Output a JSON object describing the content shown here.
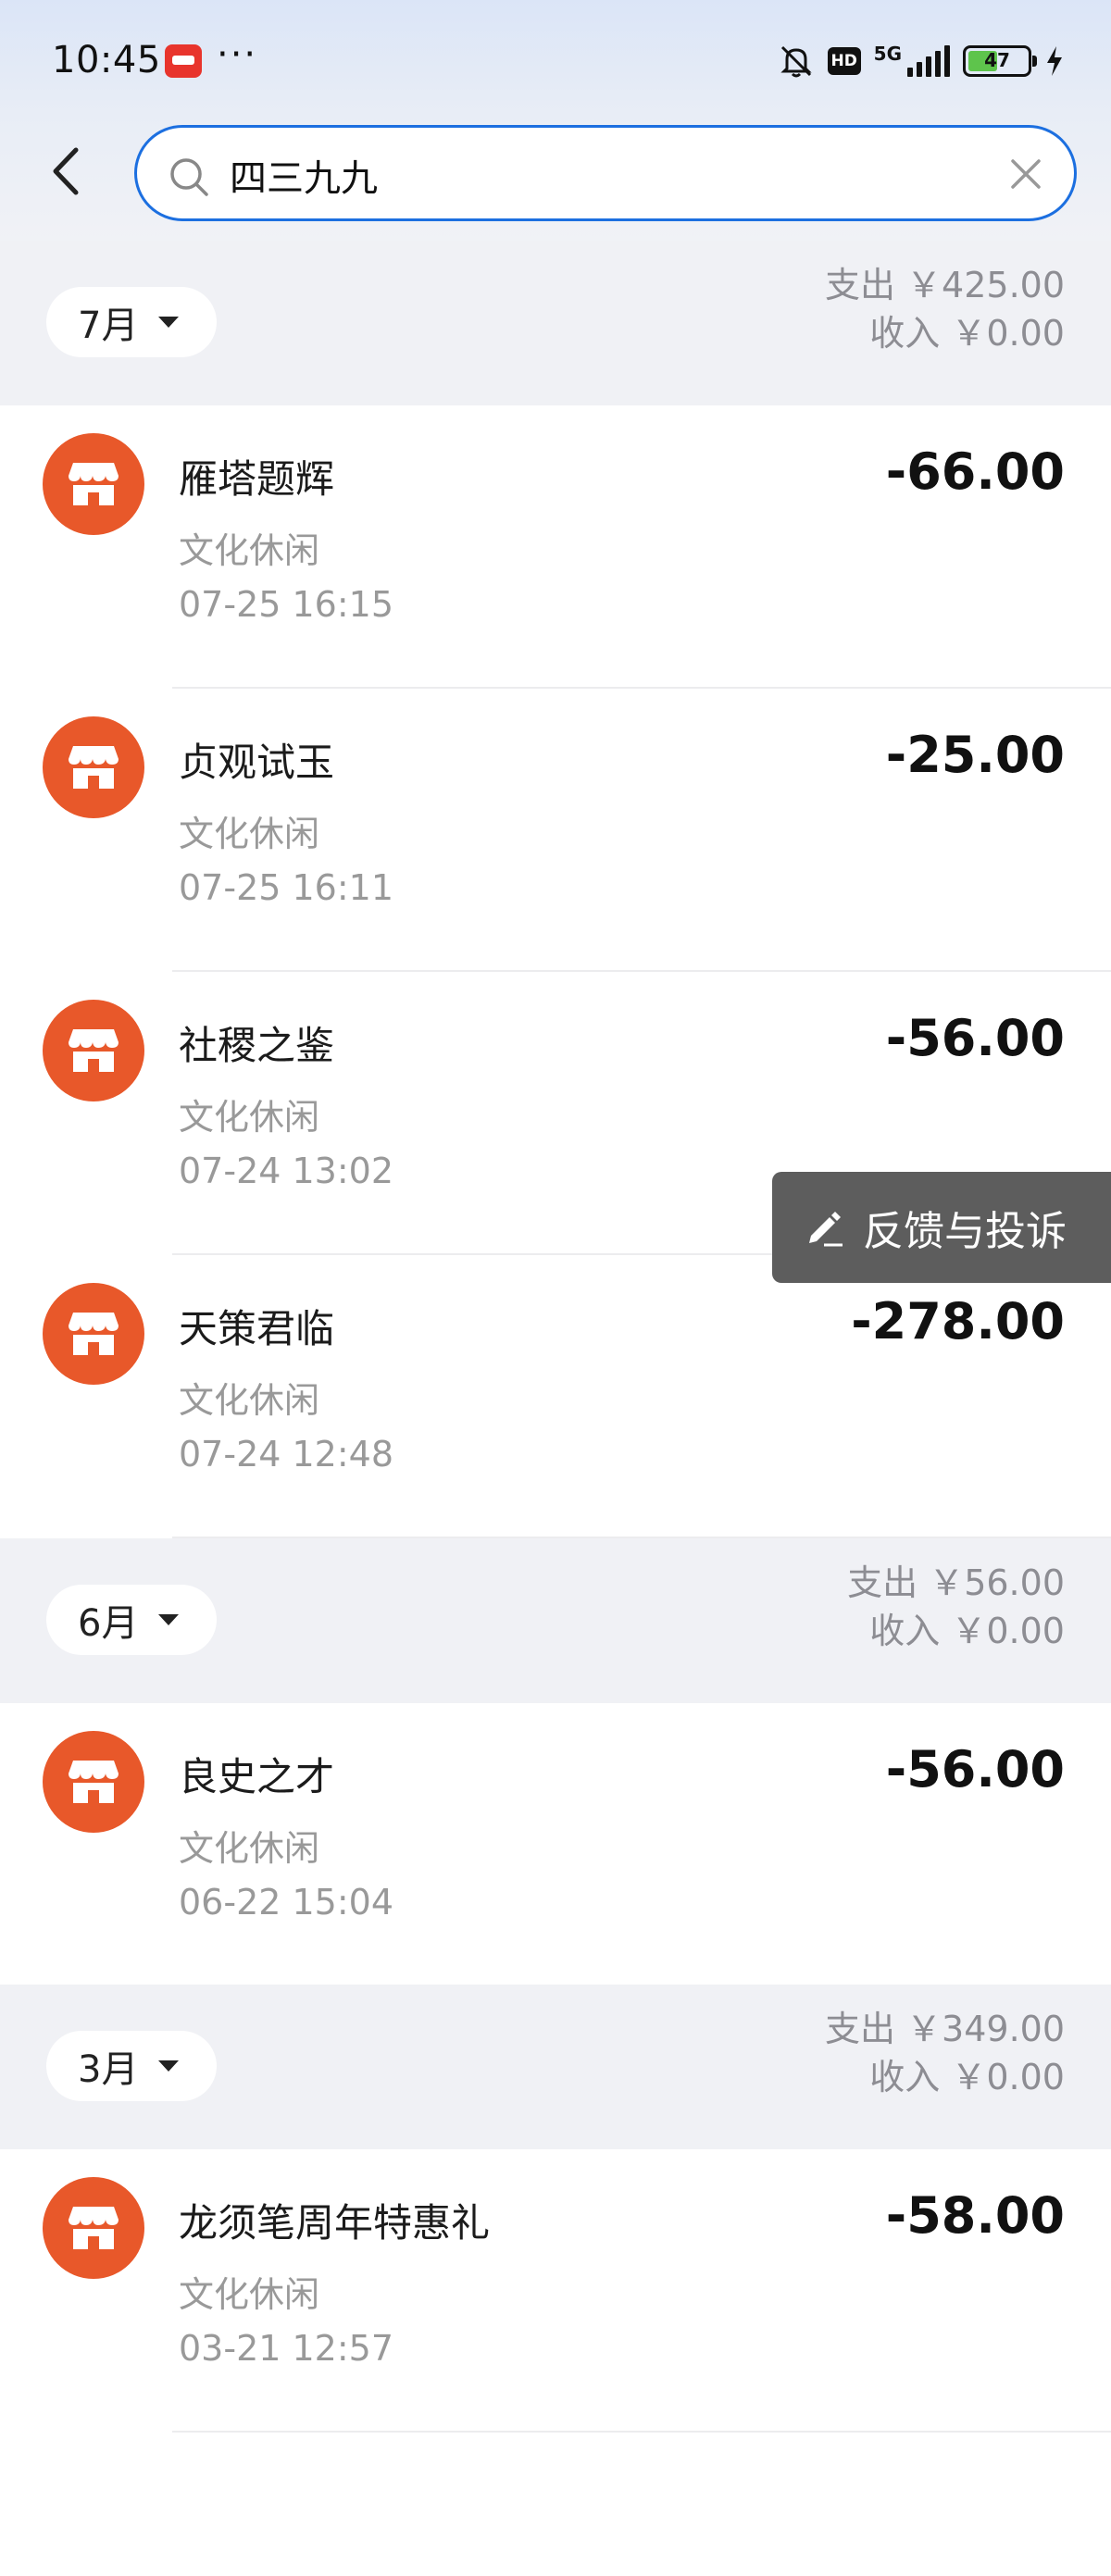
{
  "status_bar": {
    "time": "10:45",
    "more": "···",
    "hd": "HD",
    "network": "5G",
    "battery": "47"
  },
  "search": {
    "query": "四三九九",
    "placeholder": ""
  },
  "months": [
    {
      "label": "7月",
      "expense": "支出 ￥425.00",
      "income": "收入 ￥0.00",
      "transactions": [
        {
          "name": "雁塔题辉",
          "category": "文化休闲",
          "time": "07-25 16:15",
          "amount": "-66.00"
        },
        {
          "name": "贞观试玉",
          "category": "文化休闲",
          "time": "07-25 16:11",
          "amount": "-25.00"
        },
        {
          "name": "社稷之鉴",
          "category": "文化休闲",
          "time": "07-24 13:02",
          "amount": "-56.00"
        },
        {
          "name": "天策君临",
          "category": "文化休闲",
          "time": "07-24 12:48",
          "amount": "-278.00"
        }
      ]
    },
    {
      "label": "6月",
      "expense": "支出 ￥56.00",
      "income": "收入 ￥0.00",
      "transactions": [
        {
          "name": "良史之才",
          "category": "文化休闲",
          "time": "06-22 15:04",
          "amount": "-56.00"
        }
      ]
    },
    {
      "label": "3月",
      "expense": "支出 ￥349.00",
      "income": "收入 ￥0.00",
      "transactions": [
        {
          "name": "龙须笔周年特惠礼",
          "category": "文化休闲",
          "time": "03-21 12:57",
          "amount": "-58.00"
        }
      ]
    }
  ],
  "feedback": {
    "label": "反馈与投诉"
  },
  "colors": {
    "accent": "#1c6fe0",
    "merchant_icon": "#e8582a",
    "section_bg": "#f0f1f5",
    "feedback_bg": "#5d5d5d"
  },
  "icons": {
    "back": "chevron-left-icon",
    "search": "search-icon",
    "clear": "close-icon",
    "merchant": "store-icon",
    "feedback": "edit-icon"
  }
}
